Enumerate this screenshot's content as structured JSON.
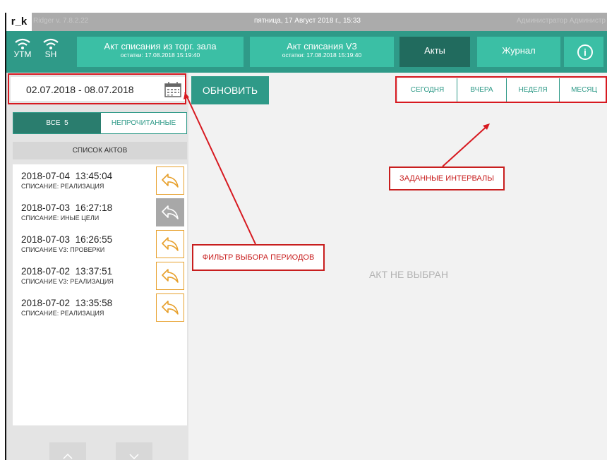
{
  "titlebar": {
    "logo": "r_k",
    "version": "Ridger v. 7.8.2.22",
    "datetime": "пятница, 17 Август 2018 г., 15:33",
    "user": "Администратор Администр"
  },
  "header": {
    "status": [
      {
        "label": "УТМ",
        "icon": "wifi-icon"
      },
      {
        "label": "SH",
        "icon": "wifi-icon"
      }
    ],
    "buttons": [
      {
        "title": "Акт списания из торг. зала",
        "sub": "остатки: 17.08.2018 15:19:40"
      },
      {
        "title": "Акт списания V3",
        "sub": "остатки: 17.08.2018 15:19:40"
      },
      {
        "title": "Акты"
      },
      {
        "title": "Журнал"
      }
    ],
    "info_icon": "info-icon",
    "colors": {
      "header_bg": "#2f9a88",
      "button_bg": "#3bbfa5",
      "active_bg": "#216b5e"
    }
  },
  "filter": {
    "date_range": "02.07.2018 - 08.07.2018",
    "calendar_icon": "calendar-icon",
    "refresh_label": "ОБНОВИТЬ",
    "periods": [
      "СЕГОДНЯ",
      "ВЧЕРА",
      "НЕДЕЛЯ",
      "МЕСЯЦ"
    ]
  },
  "tabs": {
    "all_label": "ВСЕ",
    "all_count": "5",
    "unread_label": "НЕПРОЧИТАННЫЕ"
  },
  "list": {
    "header": "СПИСОК АКТОВ",
    "items": [
      {
        "date": "2018-07-04",
        "time": "13:45:04",
        "type": "СПИСАНИЕ: РЕАЛИЗАЦИЯ",
        "state": "orange"
      },
      {
        "date": "2018-07-03",
        "time": "16:27:18",
        "type": "СПИСАНИЕ: ИНЫЕ ЦЕЛИ",
        "state": "gray"
      },
      {
        "date": "2018-07-03",
        "time": "16:26:55",
        "type": "СПИСАНИЕ V3: ПРОВЕРКИ",
        "state": "orange"
      },
      {
        "date": "2018-07-02",
        "time": "13:37:51",
        "type": "СПИСАНИЕ V3: РЕАЛИЗАЦИЯ",
        "state": "orange"
      },
      {
        "date": "2018-07-02",
        "time": "13:35:58",
        "type": "СПИСАНИЕ: РЕАЛИЗАЦИЯ",
        "state": "orange"
      }
    ],
    "reply_icon": "reply-icon"
  },
  "detail": {
    "empty_text": "АКТ НЕ ВЫБРАН"
  },
  "annotations": {
    "filter_label": "ФИЛЬТР ВЫБОРА ПЕРИОДОВ",
    "intervals_label": "ЗАДАННЫЕ ИНТЕРВАЛЫ",
    "color": "#d71920"
  }
}
